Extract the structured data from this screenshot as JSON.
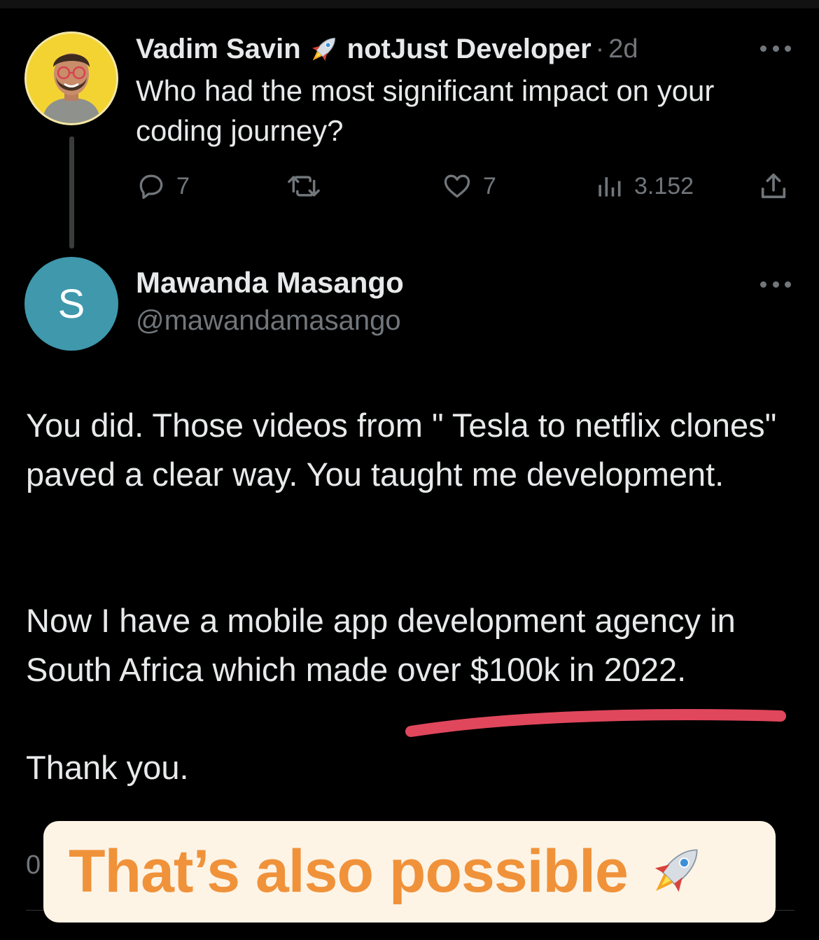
{
  "original_tweet": {
    "author_name": "Vadim Savin",
    "author_handle_name": "notJust Developer",
    "separator": "·",
    "time": "2d",
    "text": "Who had the most significant impact on your coding journey?",
    "stats": {
      "replies": "7",
      "likes": "7",
      "views": "3.152"
    }
  },
  "reply_tweet": {
    "avatar_letter": "S",
    "author_name": "Mawanda Masango",
    "author_handle": "@mawandamasango",
    "paragraph_1": "You did. Those videos from \" Tesla to netflix clones\" paved a clear way. You taught me development.",
    "paragraph_2": "Now I have a mobile app development agency in South Africa which made over $100k in 2022.",
    "paragraph_3": "Thank you.",
    "partial_line": "0"
  },
  "overlay_banner": {
    "text": "That’s also possible"
  },
  "colors": {
    "background": "#000000",
    "primary_text": "#e7e9ea",
    "secondary_text": "#71767b",
    "avatar_reply_bg": "#3f98ac",
    "underline_mark": "#e0475c",
    "banner_bg": "#fdf4e6",
    "banner_text": "#f0923a"
  },
  "icons": [
    "rocket-icon",
    "reply-icon",
    "retweet-icon",
    "like-icon",
    "views-icon",
    "share-icon",
    "more-icon"
  ]
}
